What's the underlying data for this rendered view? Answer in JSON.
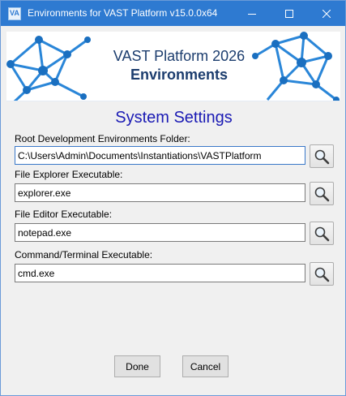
{
  "window": {
    "title": "Environments for VAST Platform v15.0.0x64"
  },
  "banner": {
    "line1": "VAST Platform 2026",
    "line2": "Environments"
  },
  "section_title": "System Settings",
  "fields": [
    {
      "label": "Root Development Environments Folder:",
      "value": "C:\\Users\\Admin\\Documents\\Instantiations\\VASTPlatform"
    },
    {
      "label": "File Explorer Executable:",
      "value": "explorer.exe"
    },
    {
      "label": "File Editor Executable:",
      "value": "notepad.exe"
    },
    {
      "label": "Command/Terminal Executable:",
      "value": "cmd.exe"
    }
  ],
  "buttons": {
    "done": "Done",
    "cancel": "Cancel"
  },
  "icons": {
    "browse": "magnifier-icon",
    "app": "vast-app-icon"
  },
  "colors": {
    "titlebar": "#2e7ad1",
    "section_title": "#1a1ab4",
    "banner_text": "#1c3d6e"
  }
}
